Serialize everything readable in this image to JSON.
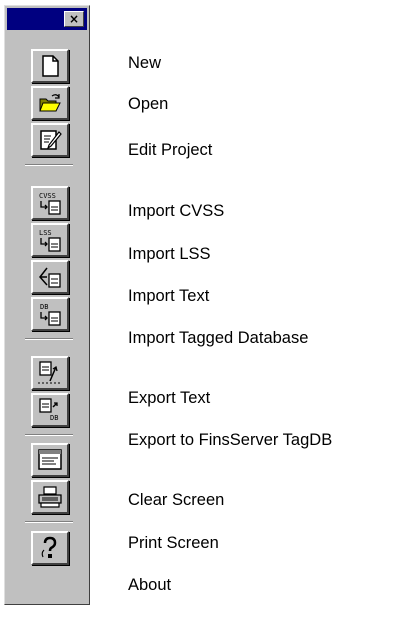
{
  "toolbar": {
    "close_glyph": "×",
    "buttons": [
      {
        "id": "new",
        "label": "New",
        "icon": "new-document-icon"
      },
      {
        "id": "open",
        "label": "Open",
        "icon": "open-folder-icon"
      },
      {
        "id": "edit-project",
        "label": "Edit Project",
        "icon": "edit-project-icon"
      },
      {
        "id": "import-cvss",
        "label": "Import CVSS",
        "icon": "import-cvss-icon",
        "icon_text": "CVSS"
      },
      {
        "id": "import-lss",
        "label": "Import LSS",
        "icon": "import-lss-icon",
        "icon_text": "LSS"
      },
      {
        "id": "import-text",
        "label": "Import Text",
        "icon": "import-text-icon"
      },
      {
        "id": "import-tagged-database",
        "label": "Import Tagged Database",
        "icon": "import-db-icon",
        "icon_text": "DB"
      },
      {
        "id": "export-text",
        "label": "Export Text",
        "icon": "export-text-icon"
      },
      {
        "id": "export-finsserver",
        "label": "Export to FinsServer TagDB",
        "icon": "export-db-icon",
        "icon_text": "DB"
      },
      {
        "id": "clear-screen",
        "label": "Clear Screen",
        "icon": "clear-screen-icon"
      },
      {
        "id": "print-screen",
        "label": "Print Screen",
        "icon": "printer-icon"
      },
      {
        "id": "about",
        "label": "About",
        "icon": "help-icon"
      }
    ]
  },
  "colors": {
    "titlebar": "#000080",
    "face": "#c0c0c0",
    "highlight": "#ffffff",
    "shadow": "#404040",
    "folder": "#ffff00"
  }
}
